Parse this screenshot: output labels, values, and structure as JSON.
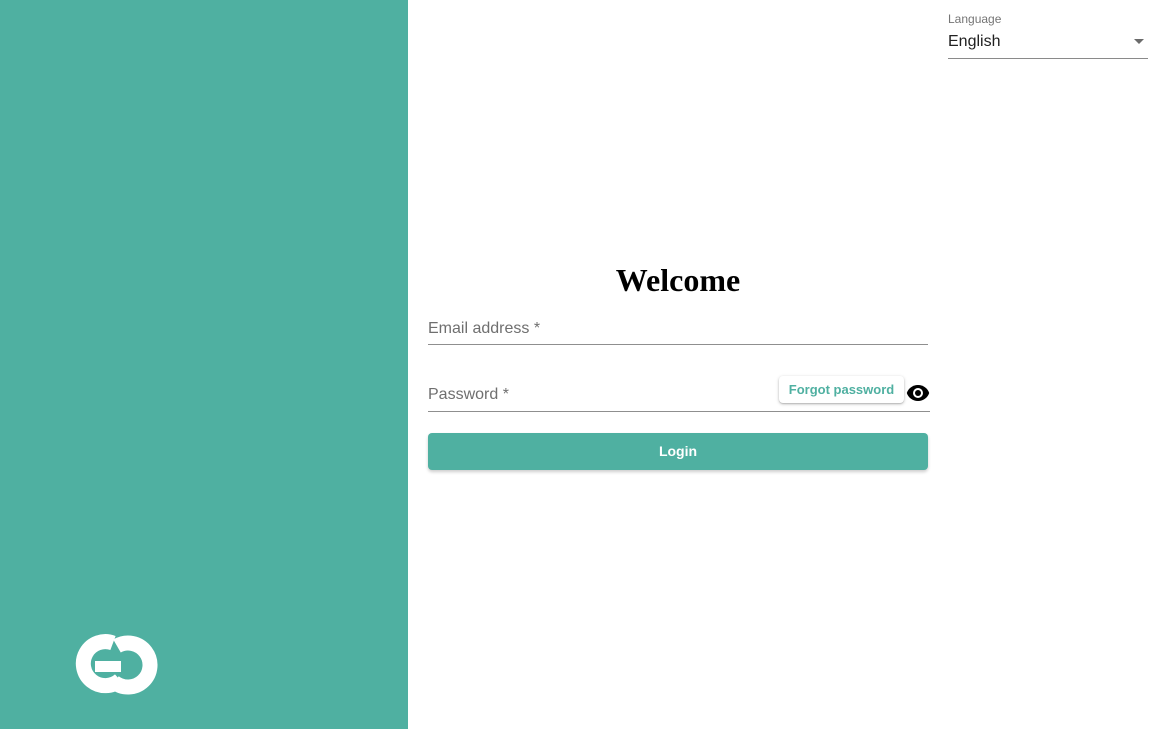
{
  "brand": {
    "panel_color": "#4fb0a1",
    "logo_icon": "gd-logo-icon"
  },
  "language": {
    "label": "Language",
    "selected": "English",
    "dropdown_icon": "caret-down-icon"
  },
  "login_form": {
    "title": "Welcome",
    "email_placeholder": "Email address *",
    "password_placeholder": "Password *",
    "forgot_password_label": "Forgot password",
    "toggle_visibility_icon": "eye-icon",
    "login_label": "Login",
    "accent_color": "#4fb0a1"
  }
}
